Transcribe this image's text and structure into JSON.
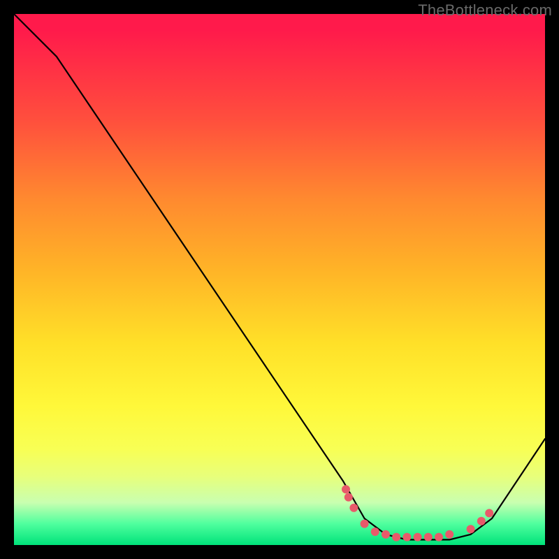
{
  "watermark": "TheBottleneck.com",
  "chart_data": {
    "type": "line",
    "title": "",
    "xlabel": "",
    "ylabel": "",
    "xlim": [
      0,
      100
    ],
    "ylim": [
      0,
      100
    ],
    "series": [
      {
        "name": "curve",
        "x": [
          0,
          8,
          62,
          66,
          70,
          74,
          78,
          82,
          86,
          90,
          100
        ],
        "y": [
          100,
          92,
          12,
          5,
          2,
          1,
          1,
          1,
          2,
          5,
          20
        ]
      }
    ],
    "markers": {
      "name": "highlight-dots",
      "color": "#e85a6a",
      "x": [
        62.5,
        63,
        64,
        66,
        68,
        70,
        72,
        74,
        76,
        78,
        80,
        82,
        86,
        88,
        89.5
      ],
      "y": [
        10.5,
        9,
        7,
        4,
        2.5,
        2,
        1.5,
        1.5,
        1.5,
        1.5,
        1.5,
        2,
        3,
        4.5,
        6
      ]
    },
    "gradient_stops": [
      {
        "pos": 0,
        "color": "#ff1a4b"
      },
      {
        "pos": 20,
        "color": "#ff4f3d"
      },
      {
        "pos": 35,
        "color": "#ff8a2f"
      },
      {
        "pos": 48,
        "color": "#ffb327"
      },
      {
        "pos": 62,
        "color": "#ffe028"
      },
      {
        "pos": 74,
        "color": "#fff83a"
      },
      {
        "pos": 87,
        "color": "#e8ff7a"
      },
      {
        "pos": 96,
        "color": "#4fff9e"
      },
      {
        "pos": 100,
        "color": "#00e27a"
      }
    ]
  }
}
